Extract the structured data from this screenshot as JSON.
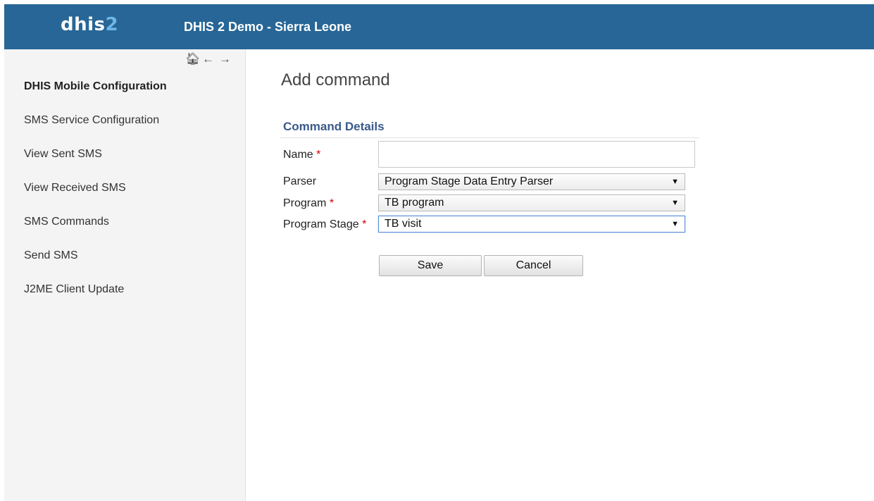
{
  "header": {
    "logo_text": "dhis",
    "logo_number": "2",
    "title": "DHIS 2 Demo - Sierra Leone",
    "colors": {
      "background": "#276696",
      "logo_accent": "#6fb6e8"
    }
  },
  "sidebar": {
    "nav_icons": [
      {
        "name": "home-icon",
        "glyph": "🏠︎"
      },
      {
        "name": "back-arrow-icon",
        "glyph": "←"
      },
      {
        "name": "forward-arrow-icon",
        "glyph": "→"
      }
    ],
    "items": [
      {
        "label": "DHIS Mobile Configuration",
        "active": true
      },
      {
        "label": "SMS Service Configuration"
      },
      {
        "label": "View Sent SMS"
      },
      {
        "label": "View Received SMS"
      },
      {
        "label": "SMS Commands"
      },
      {
        "label": "Send SMS"
      },
      {
        "label": "J2ME Client Update"
      }
    ]
  },
  "main": {
    "page_title": "Add command",
    "section_title": "Command Details",
    "form": {
      "name": {
        "label": "Name",
        "required_mark": "*",
        "value": ""
      },
      "parser": {
        "label": "Parser",
        "selected": "Program Stage Data Entry Parser"
      },
      "program": {
        "label": "Program",
        "required_mark": "*",
        "selected": "TB program"
      },
      "program_stage": {
        "label": "Program Stage",
        "required_mark": "*",
        "selected": "TB visit"
      }
    },
    "buttons": {
      "save": "Save",
      "cancel": "Cancel"
    }
  },
  "colors": {
    "section_title": "#3a5a8c",
    "required": "#cc0000"
  }
}
